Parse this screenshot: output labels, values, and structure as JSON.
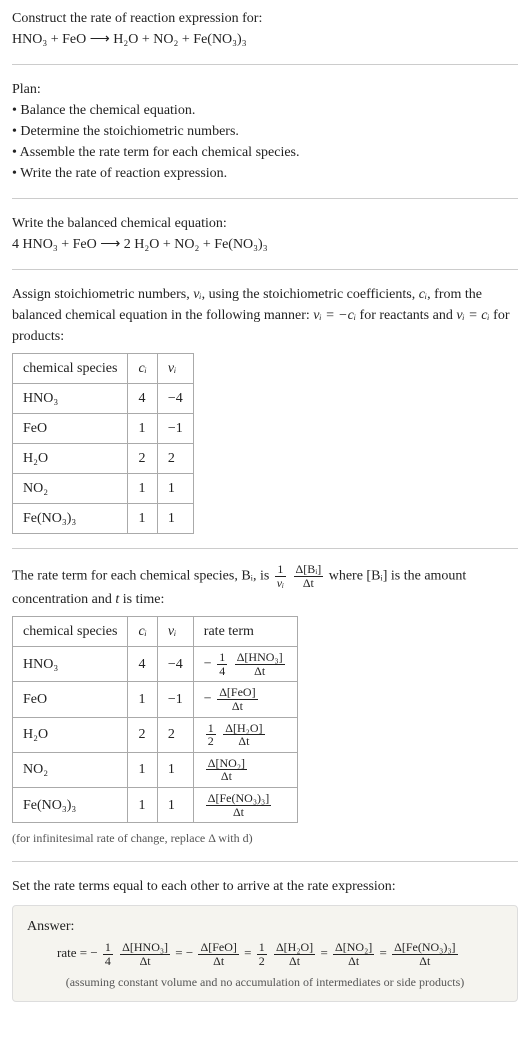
{
  "header": {
    "construct": "Construct the rate of reaction expression for:",
    "eq_unbalanced": "HNO₃ + FeO ⟶ H₂O + NO₂ + Fe(NO₃)₃"
  },
  "plan": {
    "title": "Plan:",
    "items": [
      "• Balance the chemical equation.",
      "• Determine the stoichiometric numbers.",
      "• Assemble the rate term for each chemical species.",
      "• Write the rate of reaction expression."
    ]
  },
  "balanced": {
    "intro": "Write the balanced chemical equation:",
    "eq": "4 HNO₃ + FeO ⟶ 2 H₂O + NO₂ + Fe(NO₃)₃"
  },
  "stoich": {
    "intro_a": "Assign stoichiometric numbers, ",
    "nu_i": "νᵢ",
    "intro_b": ", using the stoichiometric coefficients, ",
    "c_i": "cᵢ",
    "intro_c": ", from the balanced chemical equation in the following manner: ",
    "rel_react": "νᵢ = −cᵢ",
    "intro_d": " for reactants and ",
    "rel_prod": "νᵢ = cᵢ",
    "intro_e": " for products:",
    "table": {
      "h0": "chemical species",
      "h1": "cᵢ",
      "h2": "νᵢ",
      "rows": [
        {
          "sp": "HNO₃",
          "c": "4",
          "nu": "−4"
        },
        {
          "sp": "FeO",
          "c": "1",
          "nu": "−1"
        },
        {
          "sp": "H₂O",
          "c": "2",
          "nu": "2"
        },
        {
          "sp": "NO₂",
          "c": "1",
          "nu": "1"
        },
        {
          "sp": "Fe(NO₃)₃",
          "c": "1",
          "nu": "1"
        }
      ]
    }
  },
  "rateterm": {
    "intro_a": "The rate term for each chemical species, Bᵢ, is ",
    "frac1_num": "1",
    "frac1_den": "νᵢ",
    "frac2_num": "Δ[Bᵢ]",
    "frac2_den": "Δt",
    "intro_b": " where [Bᵢ] is the amount concentration and ",
    "t": "t",
    "intro_c": " is time:",
    "table": {
      "h0": "chemical species",
      "h1": "cᵢ",
      "h2": "νᵢ",
      "h3": "rate term",
      "rows": [
        {
          "sp": "HNO₃",
          "c": "4",
          "nu": "−4",
          "pre": "−",
          "coef_num": "1",
          "coef_den": "4",
          "dnum": "Δ[HNO₃]",
          "dden": "Δt"
        },
        {
          "sp": "FeO",
          "c": "1",
          "nu": "−1",
          "pre": "−",
          "coef_num": "",
          "coef_den": "",
          "dnum": "Δ[FeO]",
          "dden": "Δt"
        },
        {
          "sp": "H₂O",
          "c": "2",
          "nu": "2",
          "pre": "",
          "coef_num": "1",
          "coef_den": "2",
          "dnum": "Δ[H₂O]",
          "dden": "Δt"
        },
        {
          "sp": "NO₂",
          "c": "1",
          "nu": "1",
          "pre": "",
          "coef_num": "",
          "coef_den": "",
          "dnum": "Δ[NO₂]",
          "dden": "Δt"
        },
        {
          "sp": "Fe(NO₃)₃",
          "c": "1",
          "nu": "1",
          "pre": "",
          "coef_num": "",
          "coef_den": "",
          "dnum": "Δ[Fe(NO₃)₃]",
          "dden": "Δt"
        }
      ]
    },
    "footnote": "(for infinitesimal rate of change, replace Δ with d)"
  },
  "final": {
    "intro": "Set the rate terms equal to each other to arrive at the rate expression:",
    "answer_label": "Answer:",
    "rate_label": "rate = ",
    "eq_parts": [
      {
        "pre": "−",
        "coef_num": "1",
        "coef_den": "4",
        "dnum": "Δ[HNO₃]",
        "dden": "Δt"
      },
      {
        "pre": "−",
        "coef_num": "",
        "coef_den": "",
        "dnum": "Δ[FeO]",
        "dden": "Δt"
      },
      {
        "pre": "",
        "coef_num": "1",
        "coef_den": "2",
        "dnum": "Δ[H₂O]",
        "dden": "Δt"
      },
      {
        "pre": "",
        "coef_num": "",
        "coef_den": "",
        "dnum": "Δ[NO₂]",
        "dden": "Δt"
      },
      {
        "pre": "",
        "coef_num": "",
        "coef_den": "",
        "dnum": "Δ[Fe(NO₃)₃]",
        "dden": "Δt"
      }
    ],
    "eq_sep": " = ",
    "assume": "(assuming constant volume and no accumulation of intermediates or side products)"
  }
}
